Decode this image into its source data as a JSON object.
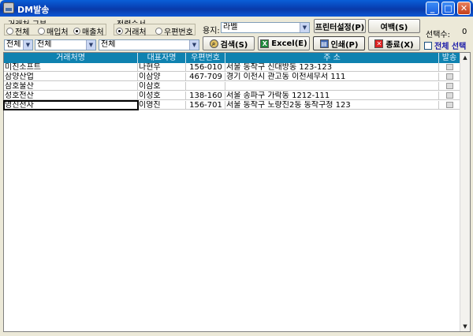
{
  "window": {
    "title": "DM발송"
  },
  "client_type": {
    "label": "거래처 구분",
    "options": [
      {
        "label": "전체",
        "selected": false
      },
      {
        "label": "매입처",
        "selected": false
      },
      {
        "label": "매출처",
        "selected": true
      }
    ]
  },
  "sort_order": {
    "label": "정렬순서",
    "options": [
      {
        "label": "거래처",
        "selected": true
      },
      {
        "label": "우편번호",
        "selected": false
      }
    ]
  },
  "paper": {
    "label": "용지:",
    "value": "라벨"
  },
  "filters": {
    "combo1": "전체",
    "combo2": "전체",
    "combo3": "전체"
  },
  "buttons": {
    "printer_setup": "프린터설정(P)",
    "margin": "여백(S)",
    "search": "검색(S)",
    "excel": "Excel(E)",
    "print": "인쇄(P)",
    "exit": "종료(X)"
  },
  "selection": {
    "label": "선택수:",
    "count": "0",
    "select_all": "전체 선택"
  },
  "grid": {
    "headers": [
      "거래처명",
      "대표자명",
      "우편번호",
      "주 소",
      "발송"
    ],
    "rows": [
      {
        "name": "미진소프트",
        "rep": "나현우",
        "zip": "156-010",
        "addr": "서울 동작구 신대방동 123-123"
      },
      {
        "name": "삼양산업",
        "rep": "이삼양",
        "zip": "467-709",
        "addr": "경기 이천시 관고동 이천세무서 111"
      },
      {
        "name": "삼호물산",
        "rep": "이삼호",
        "zip": "",
        "addr": ""
      },
      {
        "name": "성호전산",
        "rep": "이성호",
        "zip": "138-160",
        "addr": "서울 송파구 가락동 1212-111"
      },
      {
        "name": "영진전자",
        "rep": "이영진",
        "zip": "156-701",
        "addr": "서울 동작구 노량진2동 동작구청 123"
      }
    ]
  },
  "icons": {
    "search": "magnifier-icon",
    "excel": "excel-icon",
    "print": "printer-icon",
    "exit": "close-x-icon"
  },
  "colors": {
    "titlebar": "#0a3aa8",
    "grid_header": "#0f82b0",
    "select_all_text": "#1a1aa8"
  }
}
